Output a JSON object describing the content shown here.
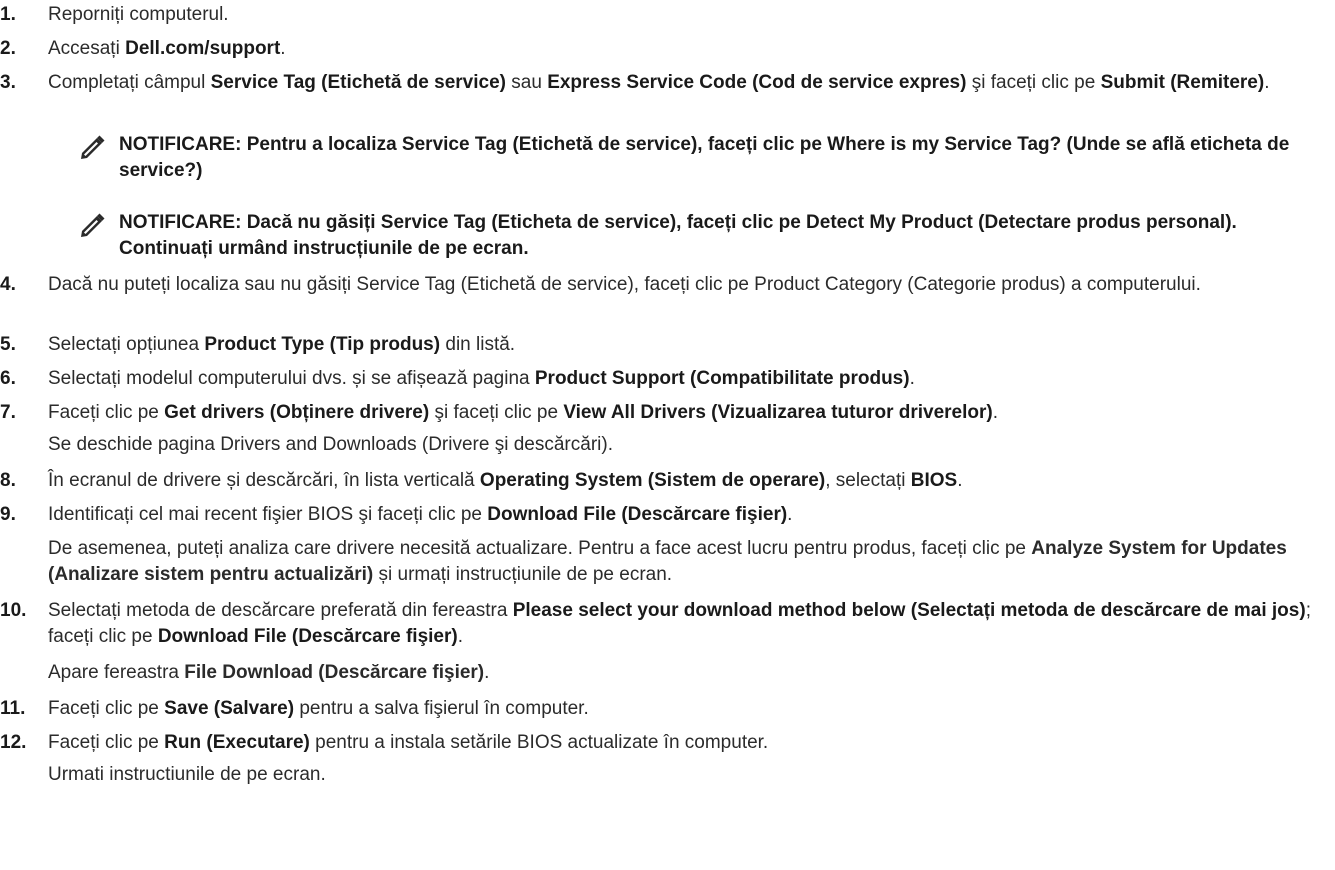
{
  "steps": [
    {
      "num": "1.",
      "parts": [
        "Reporniți computerul."
      ]
    },
    {
      "num": "2.",
      "parts": [
        "Accesați ",
        {
          "b": "Dell.com/support"
        },
        "."
      ]
    },
    {
      "num": "3.",
      "parts": [
        "Completați câmpul ",
        {
          "b": "Service Tag (Etichetă de service)"
        },
        " sau ",
        {
          "b": "Express Service Code (Cod de service expres)"
        },
        " şi faceți clic pe ",
        {
          "b": "Submit (Remitere)"
        },
        "."
      ]
    },
    {
      "num": "4.",
      "parts": [
        "Dacă nu puteți localiza sau nu găsiți Service Tag (Etichetă de service), faceți clic pe Product Category (Categorie produs) a computerului."
      ]
    },
    {
      "num": "5.",
      "parts": [
        "Selectați opțiunea ",
        {
          "b": "Product Type (Tip produs)"
        },
        " din listă."
      ]
    },
    {
      "num": "6.",
      "parts": [
        "Selectați modelul computerului dvs. și se afișează pagina ",
        {
          "b": "Product Support (Compatibilitate produs)"
        },
        "."
      ]
    },
    {
      "num": "7.",
      "parts": [
        "Faceți clic pe ",
        {
          "b": "Get drivers (Obținere drivere)"
        },
        " şi faceți clic pe ",
        {
          "b": "View All Drivers (Vizualizarea tuturor driverelor)"
        },
        "."
      ]
    },
    {
      "num": "8.",
      "parts": [
        "În ecranul de drivere și descărcări, în lista verticală ",
        {
          "b": "Operating System (Sistem de operare)"
        },
        ", selectați ",
        {
          "b": "BIOS"
        },
        "."
      ]
    },
    {
      "num": "9.",
      "parts": [
        "Identificați cel mai recent fişier BIOS şi faceți clic pe ",
        {
          "b": "Download File (Descărcare fişier)"
        },
        "."
      ]
    },
    {
      "num": "10.",
      "parts": [
        "Selectați metoda de descărcare preferată din fereastra ",
        {
          "b": "Please select your download method below (Selectați metoda de descărcare de mai jos)"
        },
        "; faceți clic pe ",
        {
          "b": "Download File (Descărcare fişier)"
        },
        "."
      ]
    },
    {
      "num": "11.",
      "parts": [
        "Faceți clic pe ",
        {
          "b": "Save (Salvare)"
        },
        " pentru a salva fişierul în computer."
      ]
    },
    {
      "num": "12.",
      "parts": [
        "Faceți clic pe ",
        {
          "b": "Run (Executare)"
        },
        " pentru a instala setările BIOS actualizate în computer."
      ]
    }
  ],
  "notes": [
    "NOTIFICARE: Pentru a localiza Service Tag (Etichetă de service), faceți clic pe Where is my Service Tag? (Unde se află eticheta de service?)",
    "NOTIFICARE: Dacă nu găsiți Service Tag (Eticheta de service), faceți clic pe Detect My Product (Detectare produs personal). Continuați urmând instrucțiunile de pe ecran."
  ],
  "sub_paragraphs": [
    {
      "after": "7.",
      "parts": [
        "Se deschide pagina Drivers and Downloads (Drivere şi descărcări)."
      ]
    },
    {
      "after": "9.",
      "parts": [
        "De asemenea, puteți analiza care drivere necesită actualizare. Pentru a face acest lucru pentru produs, faceți clic pe ",
        {
          "b": "Analyze System for Updates (Analizare sistem pentru actualizări)"
        },
        " și urmați instrucțiunile de pe ecran."
      ]
    },
    {
      "after": "10.",
      "parts": [
        "Apare fereastra ",
        {
          "b": "File Download (Descărcare fişier)"
        },
        "."
      ]
    },
    {
      "after": "12.",
      "parts": [
        "Urmati instructiunile de pe ecran."
      ]
    }
  ],
  "note_icon": "pencil-note-icon"
}
